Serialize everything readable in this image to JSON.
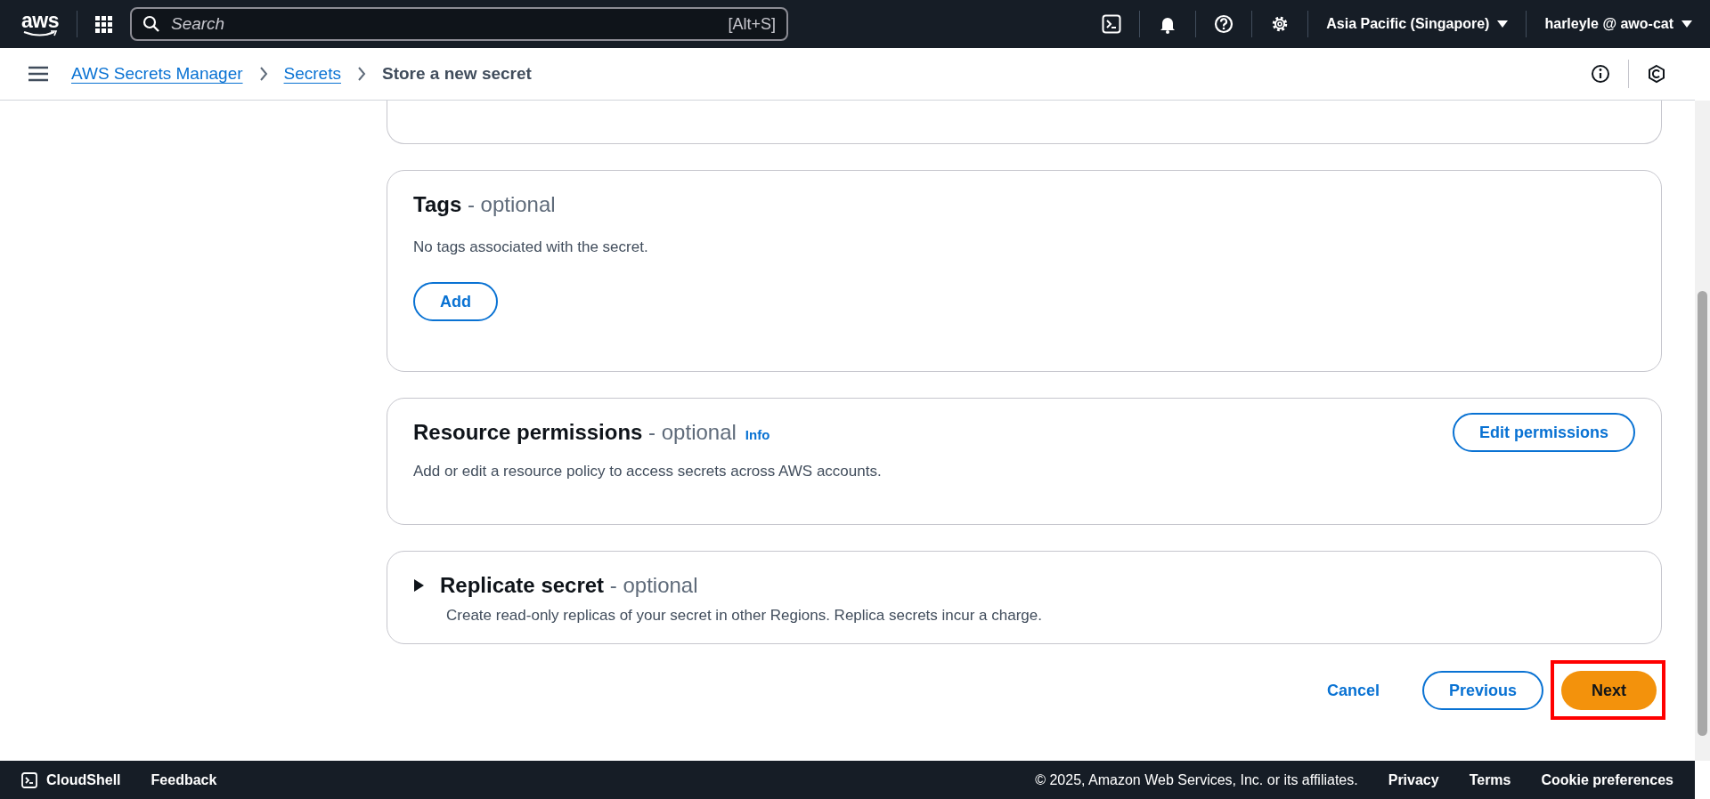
{
  "top_nav": {
    "logo": "aws",
    "search_placeholder": "Search",
    "search_shortcut": "[Alt+S]",
    "region": "Asia Pacific (Singapore)",
    "account": "harleyle @ awo-cat"
  },
  "breadcrumbs": [
    {
      "label": "AWS Secrets Manager",
      "kind": "link"
    },
    {
      "label": "Secrets",
      "kind": "link"
    },
    {
      "label": "Store a new secret",
      "kind": "current"
    }
  ],
  "tags": {
    "title": "Tags",
    "suffix": "- optional",
    "text": "No tags associated with the secret.",
    "button": "Add"
  },
  "resource_permissions": {
    "title": "Resource permissions",
    "suffix": "- optional",
    "info": "Info",
    "text": "Add or edit a resource policy to access secrets across AWS accounts.",
    "button": "Edit permissions"
  },
  "replicate": {
    "title": "Replicate secret",
    "suffix": "- optional",
    "text": "Create read-only replicas of your secret in other Regions. Replica secrets incur a charge.",
    "expanded": false
  },
  "actions": [
    {
      "label": "Cancel",
      "kind": "link",
      "highlighted": false
    },
    {
      "label": "Previous",
      "kind": "secondary",
      "highlighted": false
    },
    {
      "label": "Next",
      "kind": "primary",
      "highlighted": true
    }
  ],
  "footer": {
    "cloudshell": "CloudShell",
    "feedback": "Feedback",
    "copyright": "© 2025, Amazon Web Services, Inc. or its affiliates.",
    "links": [
      "Privacy",
      "Terms",
      "Cookie preferences"
    ]
  }
}
